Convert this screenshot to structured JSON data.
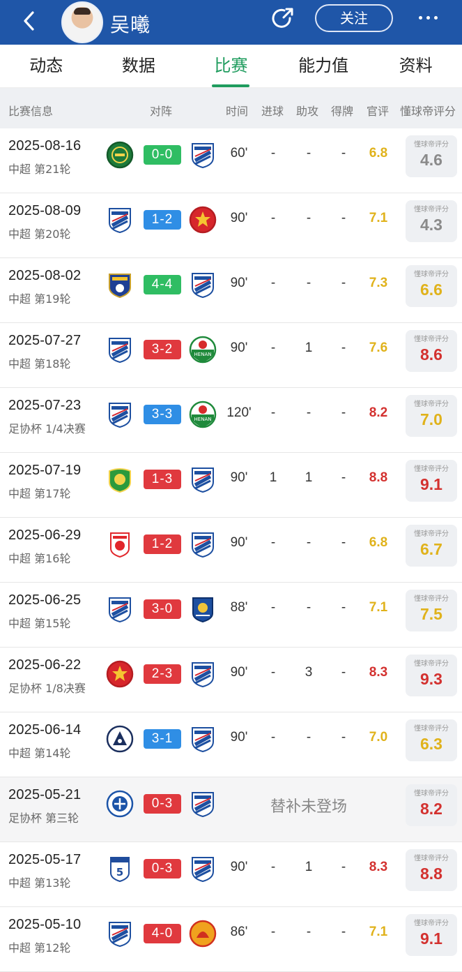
{
  "header": {
    "player_name": "吴曦",
    "follow_label": "关注"
  },
  "tabs": [
    {
      "label": "动态",
      "active": false
    },
    {
      "label": "数据",
      "active": false
    },
    {
      "label": "比赛",
      "active": true
    },
    {
      "label": "能力值",
      "active": false
    },
    {
      "label": "资料",
      "active": false
    }
  ],
  "columns": {
    "match_info": "比赛信息",
    "matchup": "对阵",
    "time": "时间",
    "goals": "进球",
    "assists": "助攻",
    "cards": "得牌",
    "official": "官评",
    "dqd_rating": "懂球帝评分"
  },
  "dqd_badge_label": "懂球帝评分",
  "colors": {
    "win": "#2fbd63",
    "draw": "#2f8ee5",
    "loss": "#e0393e",
    "rating_yellow": "#e0b21b",
    "rating_red": "#d3312f",
    "accent_green": "#1f9c5e",
    "brand_blue": "#1f56a8"
  },
  "matches": [
    {
      "date": "2025-08-16",
      "comp": "中超 第21轮",
      "home": "zhejiang",
      "away": "shenhua",
      "score": "0-0",
      "result": "win",
      "time": "60'",
      "goals": "-",
      "assists": "-",
      "cards": "-",
      "official": "6.8",
      "official_tone": "yellow",
      "dqd": "4.6",
      "dqd_tone": "gray"
    },
    {
      "date": "2025-08-09",
      "comp": "中超 第20轮",
      "home": "shenhua",
      "away": "port",
      "score": "1-2",
      "result": "draw",
      "time": "90'",
      "goals": "-",
      "assists": "-",
      "cards": "-",
      "official": "7.1",
      "official_tone": "yellow",
      "dqd": "4.3",
      "dqd_tone": "gray"
    },
    {
      "date": "2025-08-02",
      "comp": "中超 第19轮",
      "home": "yanbian",
      "away": "shenhua",
      "score": "4-4",
      "result": "win",
      "time": "90'",
      "goals": "-",
      "assists": "-",
      "cards": "-",
      "official": "7.3",
      "official_tone": "yellow",
      "dqd": "6.6",
      "dqd_tone": "yellow"
    },
    {
      "date": "2025-07-27",
      "comp": "中超 第18轮",
      "home": "shenhua",
      "away": "henan",
      "score": "3-2",
      "result": "loss",
      "time": "90'",
      "goals": "-",
      "assists": "1",
      "cards": "-",
      "official": "7.6",
      "official_tone": "yellow",
      "dqd": "8.6",
      "dqd_tone": "red"
    },
    {
      "date": "2025-07-23",
      "comp": "足协杯 1/4决赛",
      "home": "shenhua",
      "away": "henan",
      "score": "3-3",
      "result": "draw",
      "time": "120'",
      "goals": "-",
      "assists": "-",
      "cards": "-",
      "official": "8.2",
      "official_tone": "red",
      "dqd": "7.0",
      "dqd_tone": "yellow"
    },
    {
      "date": "2025-07-19",
      "comp": "中超 第17轮",
      "home": "guoan",
      "away": "shenhua",
      "score": "1-3",
      "result": "loss",
      "time": "90'",
      "goals": "1",
      "assists": "1",
      "cards": "-",
      "official": "8.8",
      "official_tone": "red",
      "dqd": "9.1",
      "dqd_tone": "red"
    },
    {
      "date": "2025-06-29",
      "comp": "中超 第16轮",
      "home": "yunnan",
      "away": "shenhua",
      "score": "1-2",
      "result": "loss",
      "time": "90'",
      "goals": "-",
      "assists": "-",
      "cards": "-",
      "official": "6.8",
      "official_tone": "yellow",
      "dqd": "6.7",
      "dqd_tone": "yellow"
    },
    {
      "date": "2025-06-25",
      "comp": "中超 第15轮",
      "home": "shenhua",
      "away": "meizhou",
      "score": "3-0",
      "result": "loss",
      "time": "88'",
      "goals": "-",
      "assists": "-",
      "cards": "-",
      "official": "7.1",
      "official_tone": "yellow",
      "dqd": "7.5",
      "dqd_tone": "yellow"
    },
    {
      "date": "2025-06-22",
      "comp": "足协杯 1/8决赛",
      "home": "port",
      "away": "shenhua",
      "score": "2-3",
      "result": "loss",
      "time": "90'",
      "goals": "-",
      "assists": "3",
      "cards": "-",
      "official": "8.3",
      "official_tone": "red",
      "dqd": "9.3",
      "dqd_tone": "red"
    },
    {
      "date": "2025-06-14",
      "comp": "中超 第14轮",
      "home": "qingdao",
      "away": "shenhua",
      "score": "3-1",
      "result": "draw",
      "time": "90'",
      "goals": "-",
      "assists": "-",
      "cards": "-",
      "official": "7.0",
      "official_tone": "yellow",
      "dqd": "6.3",
      "dqd_tone": "yellow"
    },
    {
      "date": "2025-05-21",
      "comp": "足协杯 第三轮",
      "home": "guangxi",
      "away": "shenhua",
      "score": "0-3",
      "result": "loss",
      "dnp": "替补未登场",
      "dqd": "8.2",
      "dqd_tone": "red"
    },
    {
      "date": "2025-05-17",
      "comp": "中超 第13轮",
      "home": "dalian",
      "away": "shenhua",
      "score": "0-3",
      "result": "loss",
      "time": "90'",
      "goals": "-",
      "assists": "1",
      "cards": "-",
      "official": "8.3",
      "official_tone": "red",
      "dqd": "8.8",
      "dqd_tone": "red"
    },
    {
      "date": "2025-05-10",
      "comp": "中超 第12轮",
      "home": "shenhua",
      "away": "wuhan",
      "score": "4-0",
      "result": "loss",
      "time": "86'",
      "goals": "-",
      "assists": "-",
      "cards": "-",
      "official": "7.1",
      "official_tone": "yellow",
      "dqd": "9.1",
      "dqd_tone": "red"
    }
  ]
}
